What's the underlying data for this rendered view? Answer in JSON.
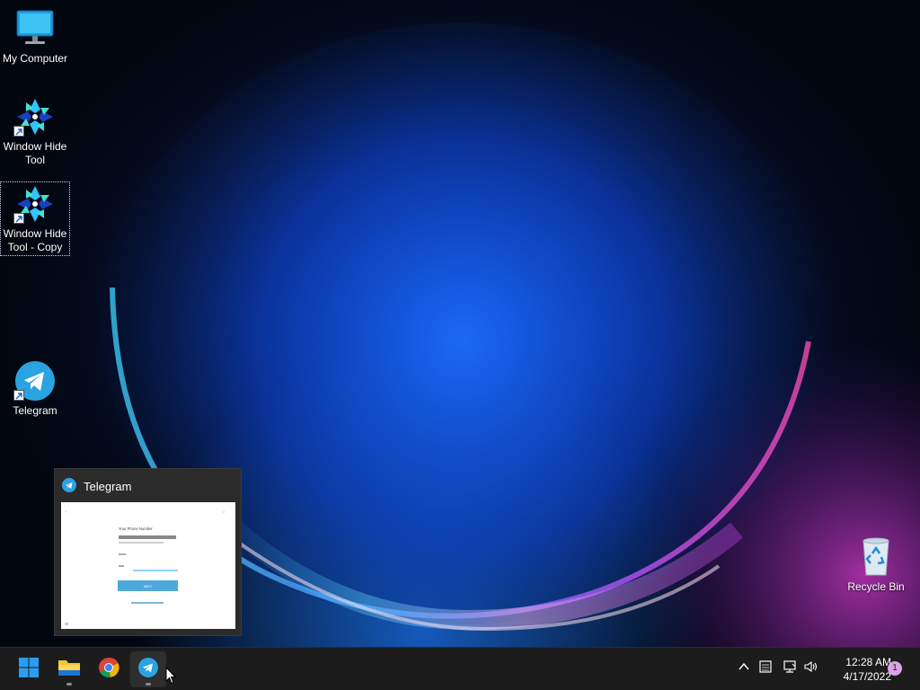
{
  "desktop": {
    "icons": [
      {
        "label": "My Computer"
      },
      {
        "label": "Window Hide Tool"
      },
      {
        "label": "Window Hide Tool - Copy"
      },
      {
        "label": "Telegram"
      },
      {
        "label": "Recycle Bin"
      }
    ]
  },
  "preview": {
    "title": "Telegram",
    "thumb": {
      "heading": "Your Phone Number",
      "button_label": "NEXT"
    }
  },
  "taskbar": {
    "apps": [
      "start-icon",
      "file-explorer-icon",
      "chrome-icon",
      "telegram-icon"
    ]
  },
  "tray": {
    "time": "12:28 AM",
    "date": "4/17/2022",
    "notifications": "1"
  },
  "colors": {
    "taskbar_bg": "#1c1c1c",
    "telegram_blue": "#2aa3e0",
    "accent_blue": "#0a6cd6"
  }
}
